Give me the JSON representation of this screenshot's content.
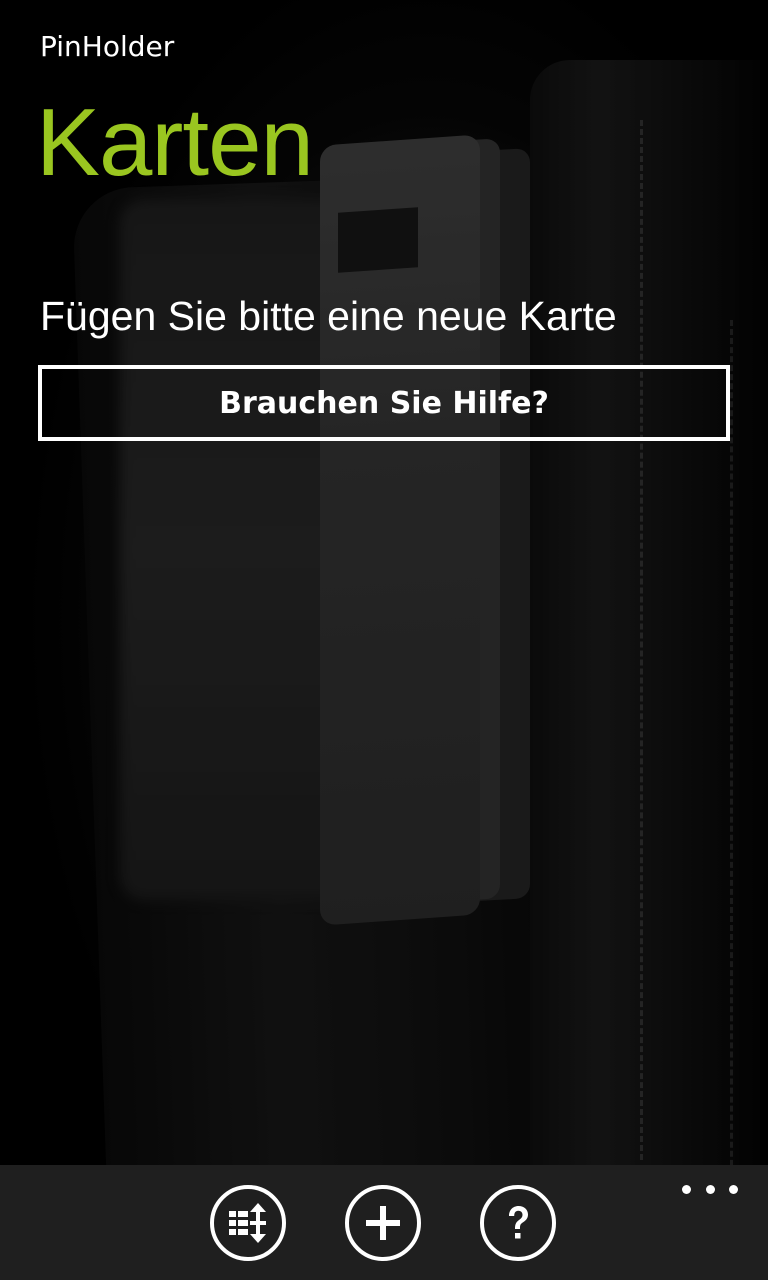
{
  "header": {
    "app_name": "PinHolder",
    "page_title": "Karten"
  },
  "main": {
    "prompt": "Fügen Sie bitte eine neue Karte",
    "help_button_label": "Brauchen Sie Hilfe?"
  },
  "app_bar": {
    "buttons": [
      {
        "icon": "reorder-icon"
      },
      {
        "icon": "add-icon"
      },
      {
        "icon": "help-icon"
      }
    ],
    "more_icon": "more-dots-icon"
  },
  "colors": {
    "accent": "#9ac620",
    "background": "#000000",
    "app_bar": "#1f1f1f",
    "text": "#ffffff"
  }
}
